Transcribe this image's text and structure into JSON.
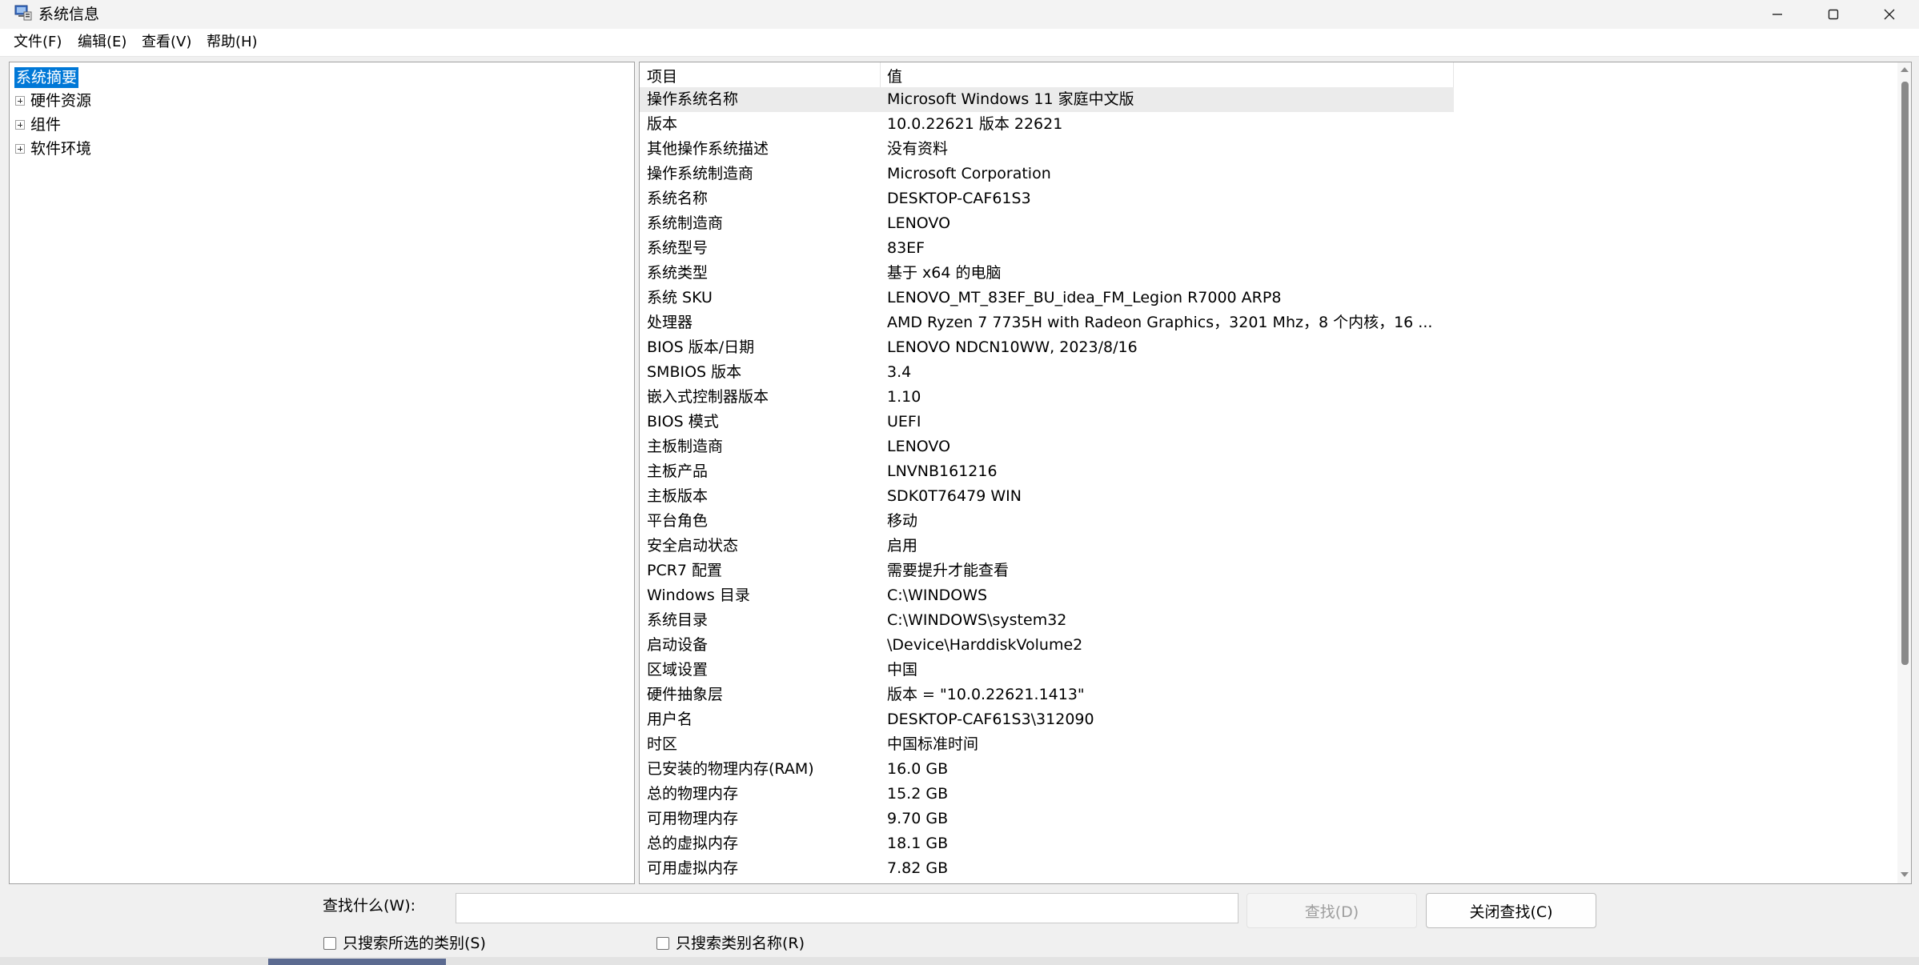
{
  "window": {
    "title": "系统信息"
  },
  "menu": [
    {
      "label": "文件(F)"
    },
    {
      "label": "编辑(E)"
    },
    {
      "label": "查看(V)"
    },
    {
      "label": "帮助(H)"
    }
  ],
  "tree": {
    "root": "系统摘要",
    "children": [
      {
        "label": "硬件资源"
      },
      {
        "label": "组件"
      },
      {
        "label": "软件环境"
      }
    ]
  },
  "list": {
    "headers": {
      "item": "项目",
      "value": "值"
    },
    "rows": [
      {
        "k": "操作系统名称",
        "v": "Microsoft Windows 11 家庭中文版"
      },
      {
        "k": "版本",
        "v": "10.0.22621 版本 22621"
      },
      {
        "k": "其他操作系统描述",
        "v": "没有资料"
      },
      {
        "k": "操作系统制造商",
        "v": "Microsoft Corporation"
      },
      {
        "k": "系统名称",
        "v": "DESKTOP-CAF61S3"
      },
      {
        "k": "系统制造商",
        "v": "LENOVO"
      },
      {
        "k": "系统型号",
        "v": "83EF"
      },
      {
        "k": "系统类型",
        "v": "基于 x64 的电脑"
      },
      {
        "k": "系统 SKU",
        "v": "LENOVO_MT_83EF_BU_idea_FM_Legion R7000 ARP8"
      },
      {
        "k": "处理器",
        "v": "AMD Ryzen 7 7735H with Radeon Graphics，3201 Mhz，8 个内核，16 ..."
      },
      {
        "k": "BIOS 版本/日期",
        "v": "LENOVO NDCN10WW, 2023/8/16"
      },
      {
        "k": "SMBIOS 版本",
        "v": "3.4"
      },
      {
        "k": "嵌入式控制器版本",
        "v": "1.10"
      },
      {
        "k": "BIOS 模式",
        "v": "UEFI"
      },
      {
        "k": "主板制造商",
        "v": "LENOVO"
      },
      {
        "k": "主板产品",
        "v": "LNVNB161216"
      },
      {
        "k": "主板版本",
        "v": "SDK0T76479 WIN"
      },
      {
        "k": "平台角色",
        "v": "移动"
      },
      {
        "k": "安全启动状态",
        "v": "启用"
      },
      {
        "k": "PCR7 配置",
        "v": "需要提升才能查看"
      },
      {
        "k": "Windows 目录",
        "v": "C:\\WINDOWS"
      },
      {
        "k": "系统目录",
        "v": "C:\\WINDOWS\\system32"
      },
      {
        "k": "启动设备",
        "v": "\\Device\\HarddiskVolume2"
      },
      {
        "k": "区域设置",
        "v": "中国"
      },
      {
        "k": "硬件抽象层",
        "v": "版本 = \"10.0.22621.1413\""
      },
      {
        "k": "用户名",
        "v": "DESKTOP-CAF61S3\\312090"
      },
      {
        "k": "时区",
        "v": "中国标准时间"
      },
      {
        "k": "已安装的物理内存(RAM)",
        "v": "16.0 GB"
      },
      {
        "k": "总的物理内存",
        "v": "15.2 GB"
      },
      {
        "k": "可用物理内存",
        "v": "9.70 GB"
      },
      {
        "k": "总的虚拟内存",
        "v": "18.1 GB"
      },
      {
        "k": "可用虚拟内存",
        "v": "7.82 GB"
      }
    ]
  },
  "find": {
    "label": "查找什么(W):",
    "value": "",
    "find_button": "查找(D)",
    "close_button": "关闭查找(C)",
    "check_selected": "只搜索所选的类别(S)",
    "check_names": "只搜索类别名称(R)"
  },
  "colors": {
    "selection": "#0078d7",
    "row_highlight": "#ebebeb"
  }
}
